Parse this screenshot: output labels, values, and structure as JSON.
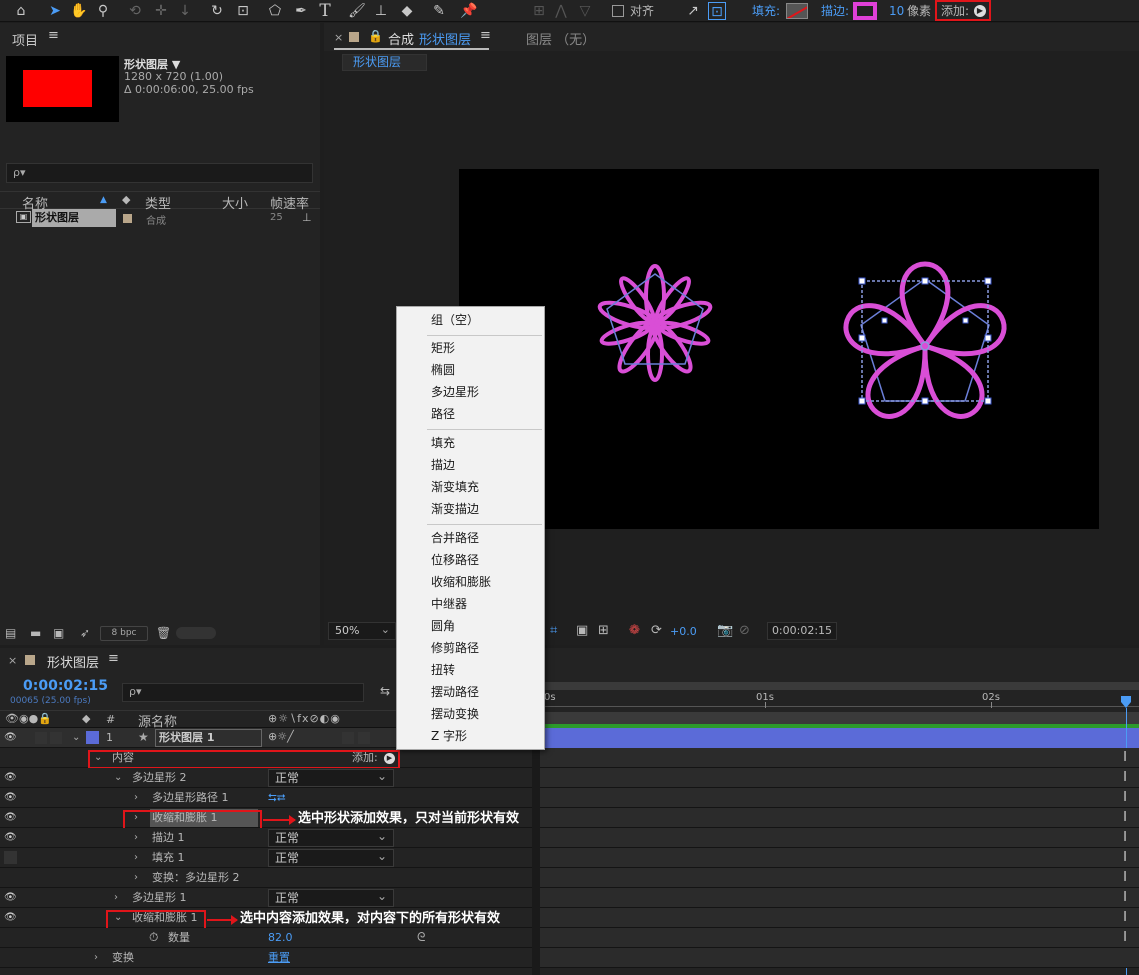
{
  "toolbar": {
    "snap_label": "对齐",
    "fill_label": "填充:",
    "stroke_label": "描边:",
    "stroke_width": "10",
    "stroke_unit": "像素",
    "add_label": "添加:",
    "stroke_color": "#e040d8"
  },
  "project": {
    "tab_label": "项目",
    "comp_name": "形状图层 ▼",
    "comp_size": "1280 x 720 (1.00)",
    "comp_duration": "Δ 0:00:06:00, 25.00 fps",
    "search_placeholder": "ρ▾",
    "columns": [
      "名称",
      "类型",
      "大小",
      "帧速率"
    ],
    "items": [
      {
        "name": "形状图层",
        "type": "合成",
        "size": "",
        "fps": "25"
      }
    ],
    "bpc_label": "8 bpc",
    "thumb_color": "#ff0000"
  },
  "composition": {
    "tab_prefix": "合成",
    "tab_name": "形状图层",
    "layer_tab": "图层 （无）",
    "breadcrumb": "形状图层",
    "zoom": "50%",
    "exposure": "+0.0",
    "timecode": "0:00:02:15"
  },
  "add_menu": {
    "groups": [
      [
        "组（空）"
      ],
      [
        "矩形",
        "椭圆",
        "多边星形",
        "路径"
      ],
      [
        "填充",
        "描边",
        "渐变填充",
        "渐变描边"
      ],
      [
        "合并路径",
        "位移路径",
        "收缩和膨胀",
        "中继器",
        "圆角",
        "修剪路径",
        "扭转",
        "摆动路径",
        "摆动变换",
        "Z 字形"
      ]
    ]
  },
  "timeline": {
    "tab_label": "形状图层",
    "timecode": "0:00:02:15",
    "frame_info": "00065 (25.00 fps)",
    "search_placeholder": "ρ▾",
    "col_num": "#",
    "col_name": "源名称",
    "ruler": [
      "0s",
      "01s",
      "02s"
    ],
    "layer": {
      "num": "1",
      "name": "形状图层 1"
    },
    "rows": [
      {
        "label": "内容",
        "extra": "添加:"
      },
      {
        "label": "多边星形 2",
        "mode": "正常"
      },
      {
        "label": "多边星形路径 1"
      },
      {
        "label": "收缩和膨胀 1"
      },
      {
        "label": "描边 1",
        "mode": "正常"
      },
      {
        "label": "填充 1",
        "mode": "正常"
      },
      {
        "label": "变换：多边星形 2"
      },
      {
        "label": "多边星形 1",
        "mode": "正常"
      },
      {
        "label": "收缩和膨胀 1"
      },
      {
        "label": "数量",
        "value": "82.0"
      },
      {
        "label": "变换",
        "value": "重置"
      }
    ]
  },
  "annotations": {
    "shape_level": "选中形状添加效果，只对当前形状有效",
    "content_level": "选中内容添加效果，对内容下的所有形状有效"
  }
}
